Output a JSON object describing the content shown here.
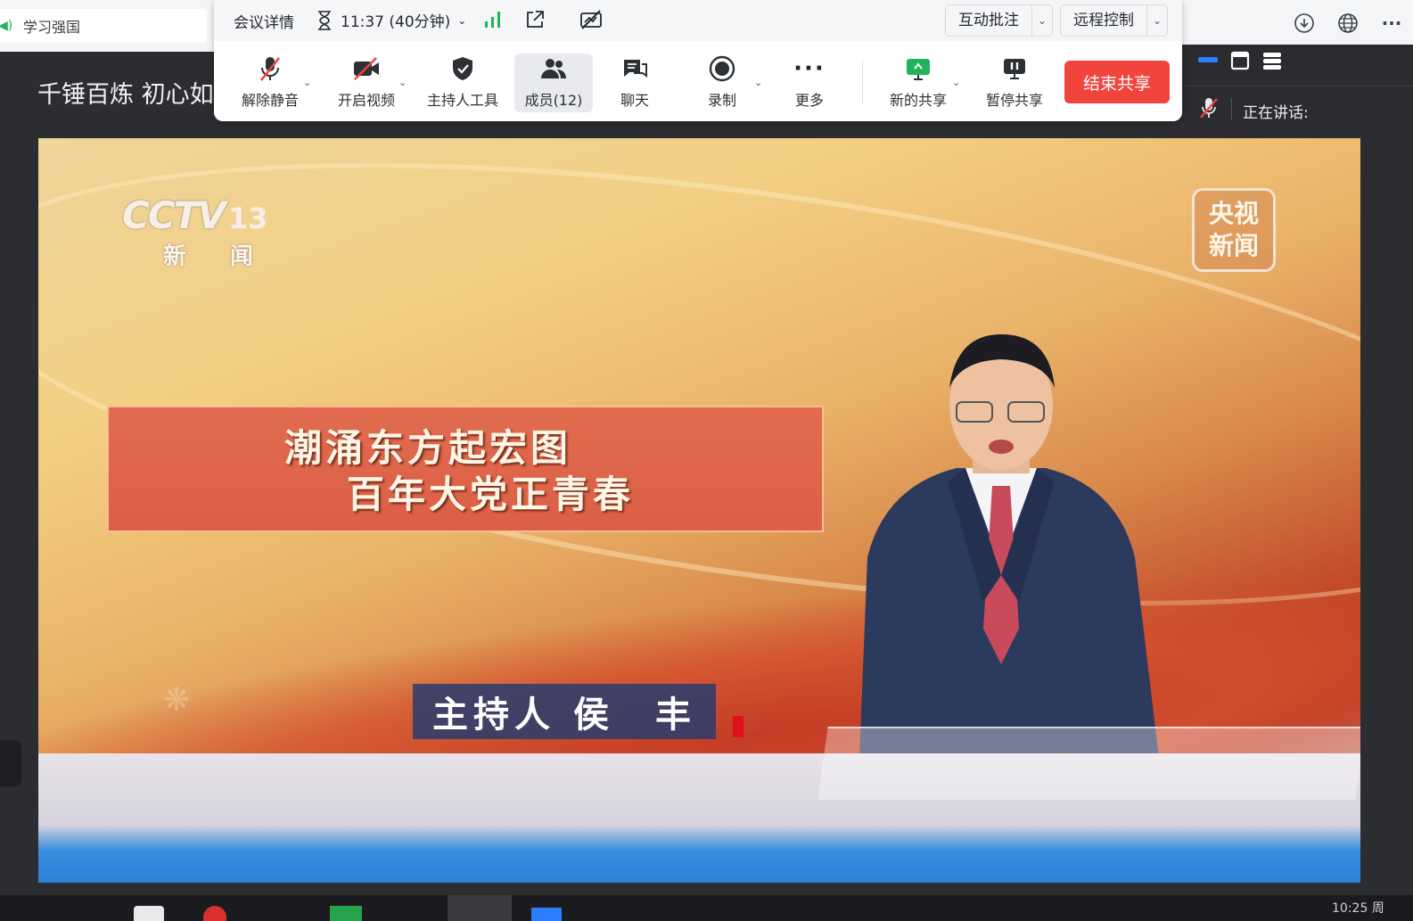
{
  "browser": {
    "tab_title": "学习强国"
  },
  "left_panel": {
    "title": "千锤百炼 初心如"
  },
  "toolbar": {
    "meeting_details": "会议详情",
    "timer": "11:37 (40分钟)",
    "annotate": "互动批注",
    "remote_control": "远程控制",
    "buttons": {
      "unmute": "解除静音",
      "start_video": "开启视频",
      "host_tools": "主持人工具",
      "members": "成员(12)",
      "chat": "聊天",
      "record": "录制",
      "more": "更多",
      "new_share": "新的共享",
      "pause_share": "暂停共享",
      "end_share": "结束共享"
    }
  },
  "right_panel": {
    "speaking": "正在讲话:"
  },
  "video": {
    "channel_logo": "CCTV",
    "channel_number": "13",
    "channel_sub": "新 闻",
    "badge": "央视新闻",
    "headline_line1": "潮涌东方起宏图",
    "headline_line2": "百年大党正青春",
    "presenter_caption": "主持人 侯　丰"
  },
  "taskbar": {
    "clock": "10:25 周"
  },
  "colors": {
    "end_share_bg": "#f0443d",
    "signal_green": "#21b35a",
    "accent_blue": "#2b7fff"
  }
}
